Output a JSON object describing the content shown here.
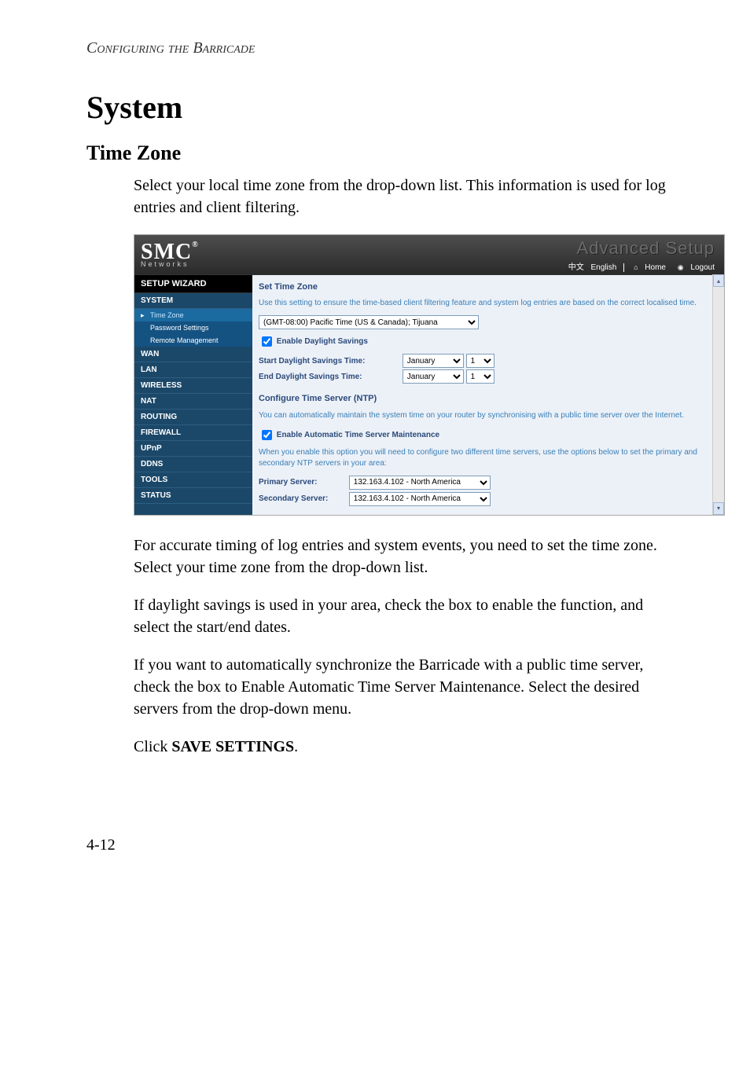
{
  "doc": {
    "running_header": "Configuring the Barricade",
    "h1": "System",
    "h2": "Time Zone",
    "p1": "Select your local time zone from the drop-down list. This information is used for log entries and client filtering.",
    "p2": "For accurate timing of log entries and system events, you need to set the time zone. Select your time zone from the drop-down list.",
    "p3": "If daylight savings is used in your area, check the box to enable the function, and select the start/end dates.",
    "p4": "If you want to automatically synchronize the Barricade with a public time server, check the box to Enable Automatic Time Server Maintenance. Select the desired servers from the drop-down menu.",
    "p5_prefix": "Click ",
    "p5_bold": "SAVE SETTINGS",
    "p5_suffix": ".",
    "page_number": "4-12"
  },
  "ui": {
    "brand": {
      "logo": "SMC",
      "reg": "®",
      "sub": "Networks",
      "adv": "Advanced Setup",
      "chinese": "中文",
      "english": "English",
      "home": "Home",
      "logout": "Logout"
    },
    "sidebar": {
      "setup_wizard": "SETUP WIZARD",
      "system": "SYSTEM",
      "time_zone": "Time Zone",
      "password_settings": "Password Settings",
      "remote_management": "Remote Management",
      "wan": "WAN",
      "lan": "LAN",
      "wireless": "WIRELESS",
      "nat": "NAT",
      "routing": "ROUTING",
      "firewall": "FIREWALL",
      "upnp": "UPnP",
      "ddns": "DDNS",
      "tools": "TOOLS",
      "status": "STATUS"
    },
    "content": {
      "title": "Set Time Zone",
      "desc": "Use this setting to ensure the time-based client filtering feature and system log entries are based on the correct localised time.",
      "tz_selected": "(GMT-08:00) Pacific Time (US & Canada); Tijuana",
      "enable_ds": "Enable Daylight Savings",
      "start_label": "Start Daylight Savings Time:",
      "end_label": "End Daylight Savings Time:",
      "month": "January",
      "day": "1",
      "ntp_title": "Configure Time Server (NTP)",
      "ntp_desc": "You can automatically maintain the system time on your router by synchronising with a public time server over the Internet.",
      "enable_auto": "Enable Automatic Time Server Maintenance",
      "auto_desc": "When you enable this option you will need to configure two different time servers, use the options below to set the primary and secondary NTP servers in your area:",
      "primary_label": "Primary Server:",
      "secondary_label": "Secondary Server:",
      "server_value": "132.163.4.102 - North America"
    }
  }
}
